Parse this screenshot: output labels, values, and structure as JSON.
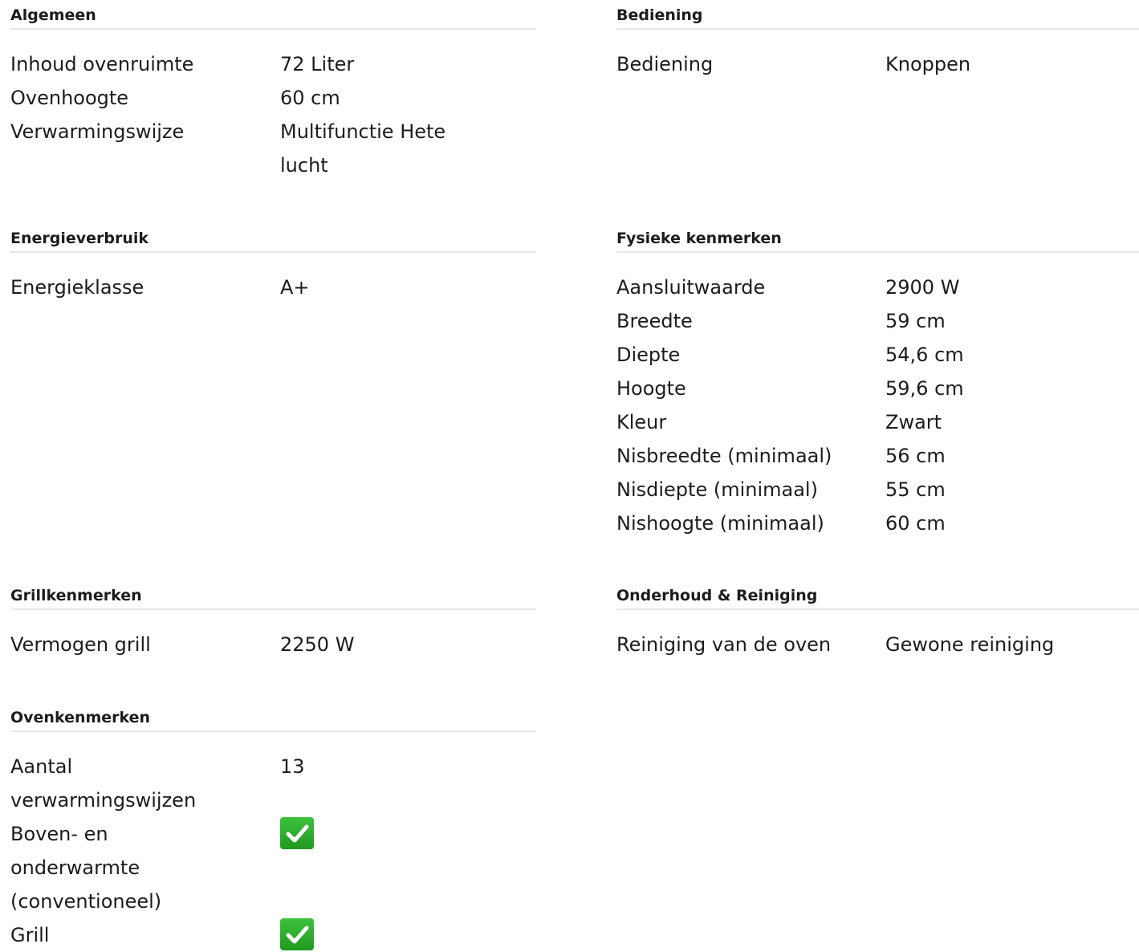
{
  "sections_left": [
    {
      "title": "Algemeen",
      "rows": [
        {
          "label": "Inhoud ovenruimte",
          "value": "72 Liter"
        },
        {
          "label": "Ovenhoogte",
          "value": "60 cm"
        },
        {
          "label": "Verwarmingswijze",
          "value": "Multifunctie Hete lucht"
        }
      ]
    },
    {
      "title": "Energieverbruik",
      "rows": [
        {
          "label": "Energieklasse",
          "value": "A+"
        }
      ]
    },
    {
      "title": "Grillkenmerken",
      "rows": [
        {
          "label": "Vermogen grill",
          "value": "2250 W"
        }
      ]
    },
    {
      "title": "Ovenkenmerken",
      "rows": [
        {
          "label": "Aantal verwarmingswijzen",
          "value": "13"
        },
        {
          "label": "Boven- en onderwarmte (conventioneel)",
          "value": "check-icon"
        },
        {
          "label": "Grill",
          "value": "check-icon"
        }
      ]
    }
  ],
  "sections_right": [
    {
      "title": "Bediening",
      "rows": [
        {
          "label": "Bediening",
          "value": "Knoppen"
        }
      ]
    },
    {
      "title": "Fysieke kenmerken",
      "rows": [
        {
          "label": "Aansluitwaarde",
          "value": "2900 W"
        },
        {
          "label": "Breedte",
          "value": "59 cm"
        },
        {
          "label": "Diepte",
          "value": "54,6 cm"
        },
        {
          "label": "Hoogte",
          "value": "59,6 cm"
        },
        {
          "label": "Kleur",
          "value": "Zwart"
        },
        {
          "label": "Nisbreedte (minimaal)",
          "value": "56 cm"
        },
        {
          "label": "Nisdiepte (minimaal)",
          "value": "55 cm"
        },
        {
          "label": "Nishoogte (minimaal)",
          "value": "60 cm"
        }
      ]
    },
    {
      "title": "Onderhoud & Reiniging",
      "rows": [
        {
          "label": "Reiniging van de oven",
          "value": "Gewone reiniging"
        }
      ]
    }
  ],
  "colors": {
    "text": "#1c1c1c",
    "divider": "#e8e8e8",
    "check_green": "#2eb52e"
  }
}
